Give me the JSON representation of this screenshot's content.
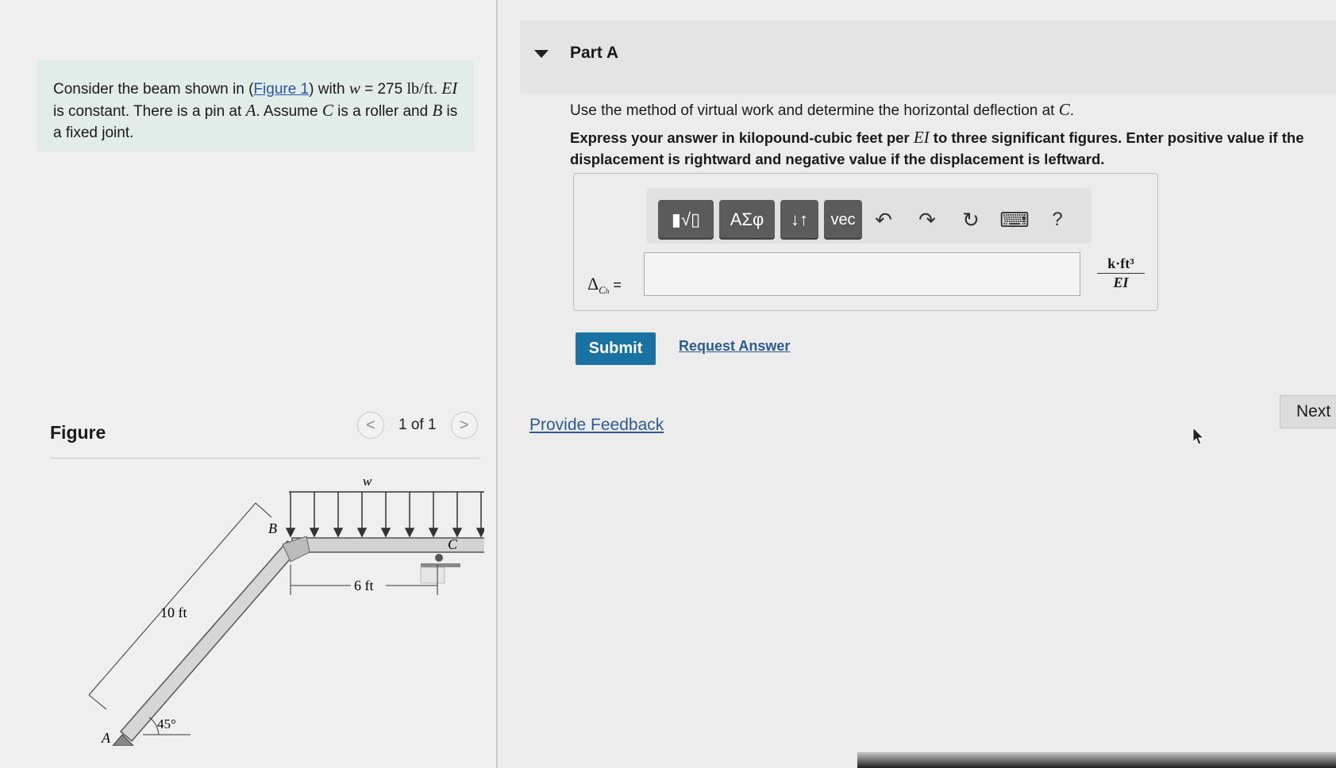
{
  "problem": {
    "t1": "Consider the beam shown in (",
    "figure_link": "Figure 1",
    "t2": ") with ",
    "w_var": "w",
    "t3": " = 275",
    "unit": "lb/ft",
    "t4": ". ",
    "ei_var": "EI",
    "t5": " is constant. There is a pin at ",
    "a_var": "A",
    "t6": ". Assume ",
    "c_var": "C",
    "t7": " is a roller and ",
    "b_var": "B",
    "t8": " is a fixed joint."
  },
  "figure": {
    "title": "Figure",
    "prev_label": "<",
    "next_label": ">",
    "count": "1 of 1",
    "labels": {
      "w": "w",
      "B": "B",
      "C": "C",
      "A": "A",
      "six_ft": "6 ft",
      "ten_ft": "10 ft",
      "angle": "45°"
    }
  },
  "part": {
    "title": "Part A",
    "instruction_text": "Use the method of virtual work and determine the horizontal deflection at ",
    "instruction_var": "C",
    "instruction_end": ".",
    "express_1": "Express your answer in kilopound-cubic feet per ",
    "express_var": "EI",
    "express_2": " to three significant figures. Enter positive value if the displacement is rightward and negative value if the displacement is leftward."
  },
  "toolbar": {
    "templates_label": "▮√▯",
    "greek_label": "ΑΣφ",
    "arrows_label": "↓↑",
    "vec_label": "vec",
    "undo_icon": "↶",
    "redo_icon": "↷",
    "reset_icon": "↻",
    "keyboard_icon": "⌨",
    "help_label": "?"
  },
  "answer": {
    "label_delta": "Δ",
    "label_sub": "C",
    "label_subsub": "h",
    "label_eq": " =",
    "value": "",
    "units_num": "k·ft³",
    "units_den": "EI"
  },
  "actions": {
    "submit_label": "Submit",
    "request_label": "Request Answer",
    "feedback_label": "Provide Feedback",
    "next_label": "Next"
  }
}
